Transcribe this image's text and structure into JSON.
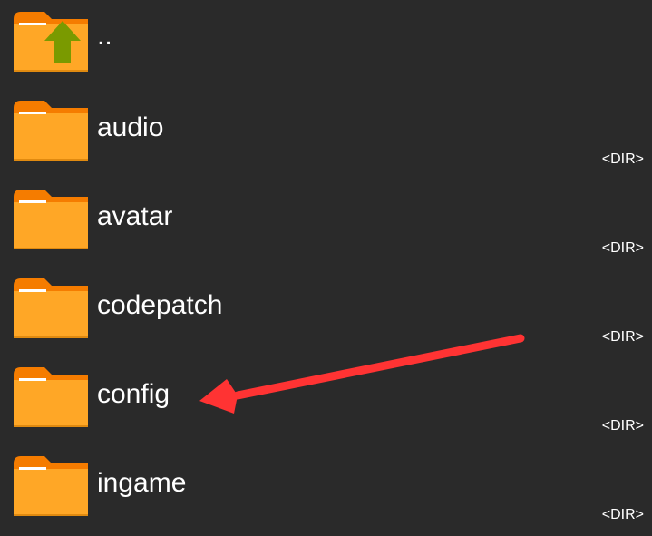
{
  "file_list": {
    "items": [
      {
        "name": "..",
        "type_tag": "",
        "icon": "folder-up-icon"
      },
      {
        "name": "audio",
        "type_tag": "<DIR>",
        "icon": "folder-icon"
      },
      {
        "name": "avatar",
        "type_tag": "<DIR>",
        "icon": "folder-icon"
      },
      {
        "name": "codepatch",
        "type_tag": "<DIR>",
        "icon": "folder-icon"
      },
      {
        "name": "config",
        "type_tag": "<DIR>",
        "icon": "folder-icon"
      },
      {
        "name": "ingame",
        "type_tag": "<DIR>",
        "icon": "folder-icon"
      }
    ]
  },
  "annotation": {
    "icon": "red-arrow-annotation",
    "color": "#ff3333"
  },
  "colors": {
    "background": "#2a2a2a",
    "folder_body": "#ffa726",
    "folder_tab": "#f57c00",
    "up_arrow": "#7a9a00"
  }
}
